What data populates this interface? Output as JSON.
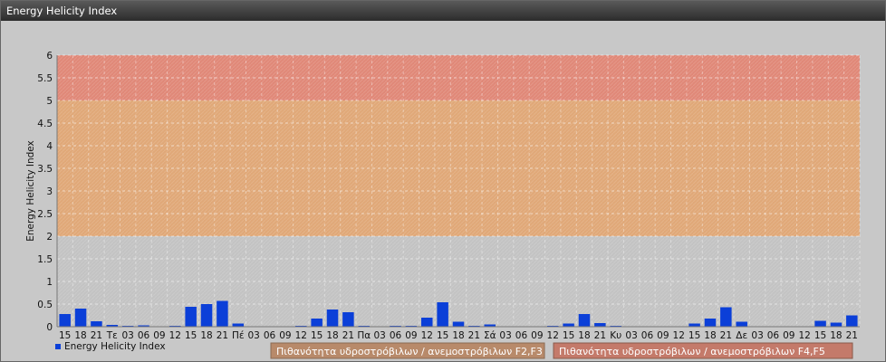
{
  "window": {
    "title": "Energy Helicity Index"
  },
  "colors": {
    "plot_bg": "#c3c3c3",
    "band_high": "#e08878",
    "band_mid": "#e0a878",
    "bar": "#0b3fd8",
    "legend_f23": "#b88a6a",
    "legend_f45": "#c47a6a"
  },
  "chart_data": {
    "type": "bar",
    "ylabel": "Energy Helicity Index",
    "ylim": [
      0,
      6
    ],
    "yticks": [
      "0",
      "0.5",
      "1",
      "1.5",
      "2",
      "2.5",
      "3",
      "3.5",
      "4",
      "4.5",
      "5",
      "5.5",
      "6"
    ],
    "bands": [
      {
        "from": 2,
        "to": 5,
        "color": "#e0a878"
      },
      {
        "from": 5,
        "to": 6,
        "color": "#e08878"
      }
    ],
    "categories": [
      "15",
      "18",
      "21",
      "Τε",
      "03",
      "06",
      "09",
      "12",
      "15",
      "18",
      "21",
      "Πέ",
      "03",
      "06",
      "09",
      "12",
      "15",
      "18",
      "21",
      "Πα",
      "03",
      "06",
      "09",
      "12",
      "15",
      "18",
      "21",
      "Σά",
      "03",
      "06",
      "09",
      "12",
      "15",
      "18",
      "21",
      "Κυ",
      "03",
      "06",
      "09",
      "12",
      "15",
      "18",
      "21",
      "Δε",
      "03",
      "06",
      "09",
      "12",
      "15",
      "18",
      "21"
    ],
    "series": [
      {
        "name": "Energy Helicity Index",
        "values": [
          0.28,
          0.4,
          0.12,
          0.04,
          0.02,
          0.03,
          0.01,
          0.02,
          0.44,
          0.5,
          0.57,
          0.07,
          0.01,
          0.01,
          0.01,
          0.02,
          0.18,
          0.38,
          0.32,
          0.02,
          0.01,
          0.02,
          0.02,
          0.2,
          0.54,
          0.11,
          0.02,
          0.05,
          0.01,
          0.01,
          0.01,
          0.02,
          0.07,
          0.28,
          0.08,
          0.02,
          0.01,
          0.01,
          0.01,
          0.01,
          0.07,
          0.18,
          0.43,
          0.11,
          0.01,
          0.01,
          0.01,
          0.01,
          0.13,
          0.09,
          0.25
        ]
      }
    ],
    "legend": {
      "series_label": "Energy Helicity Index",
      "risk_f23": "Πιθανότητα υδροστρόβιλων / ανεμοστρόβιλων F2,F3",
      "risk_f45": "Πιθανότητα υδροστρόβιλων / ανεμοστρόβιλων F4,F5"
    }
  }
}
